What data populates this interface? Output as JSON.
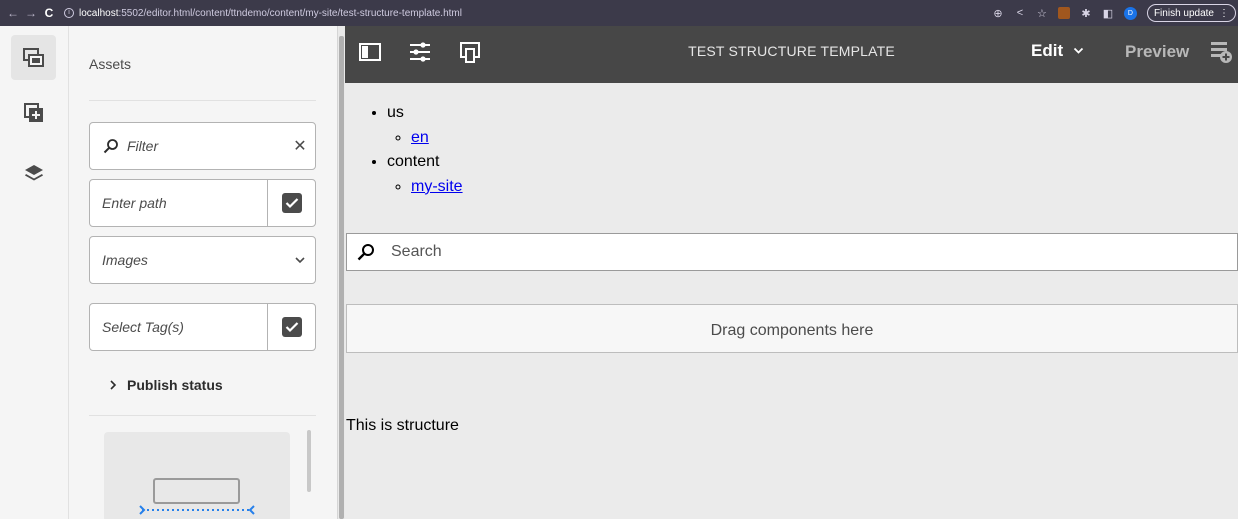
{
  "browser": {
    "url_host": "localhost",
    "url_rest": ":5502/editor.html/content/ttndemo/content/my-site/test-structure-template.html",
    "profile_initial": "D",
    "finish_update_label": "Finish update"
  },
  "rail": {
    "items": [
      {
        "name": "assets",
        "icon": "assets-icon",
        "active": true
      },
      {
        "name": "components",
        "icon": "add-components-icon",
        "active": false
      },
      {
        "name": "content-tree",
        "icon": "layers-icon",
        "active": false
      }
    ]
  },
  "panel": {
    "title": "Assets",
    "filter_placeholder": "Filter",
    "path_placeholder": "Enter path",
    "type_value": "Images",
    "tags_placeholder": "Select Tag(s)",
    "publish_status_label": "Publish status"
  },
  "editor": {
    "title": "TEST STRUCTURE TEMPLATE",
    "mode_label": "Edit",
    "preview_label": "Preview"
  },
  "page": {
    "nav": [
      {
        "label": "us",
        "children": [
          {
            "label": "en"
          }
        ]
      },
      {
        "label": "content",
        "children": [
          {
            "label": "my-site"
          }
        ]
      }
    ],
    "search_placeholder": "Search",
    "dropzone_label": "Drag components here",
    "structure_text": "This is structure"
  }
}
